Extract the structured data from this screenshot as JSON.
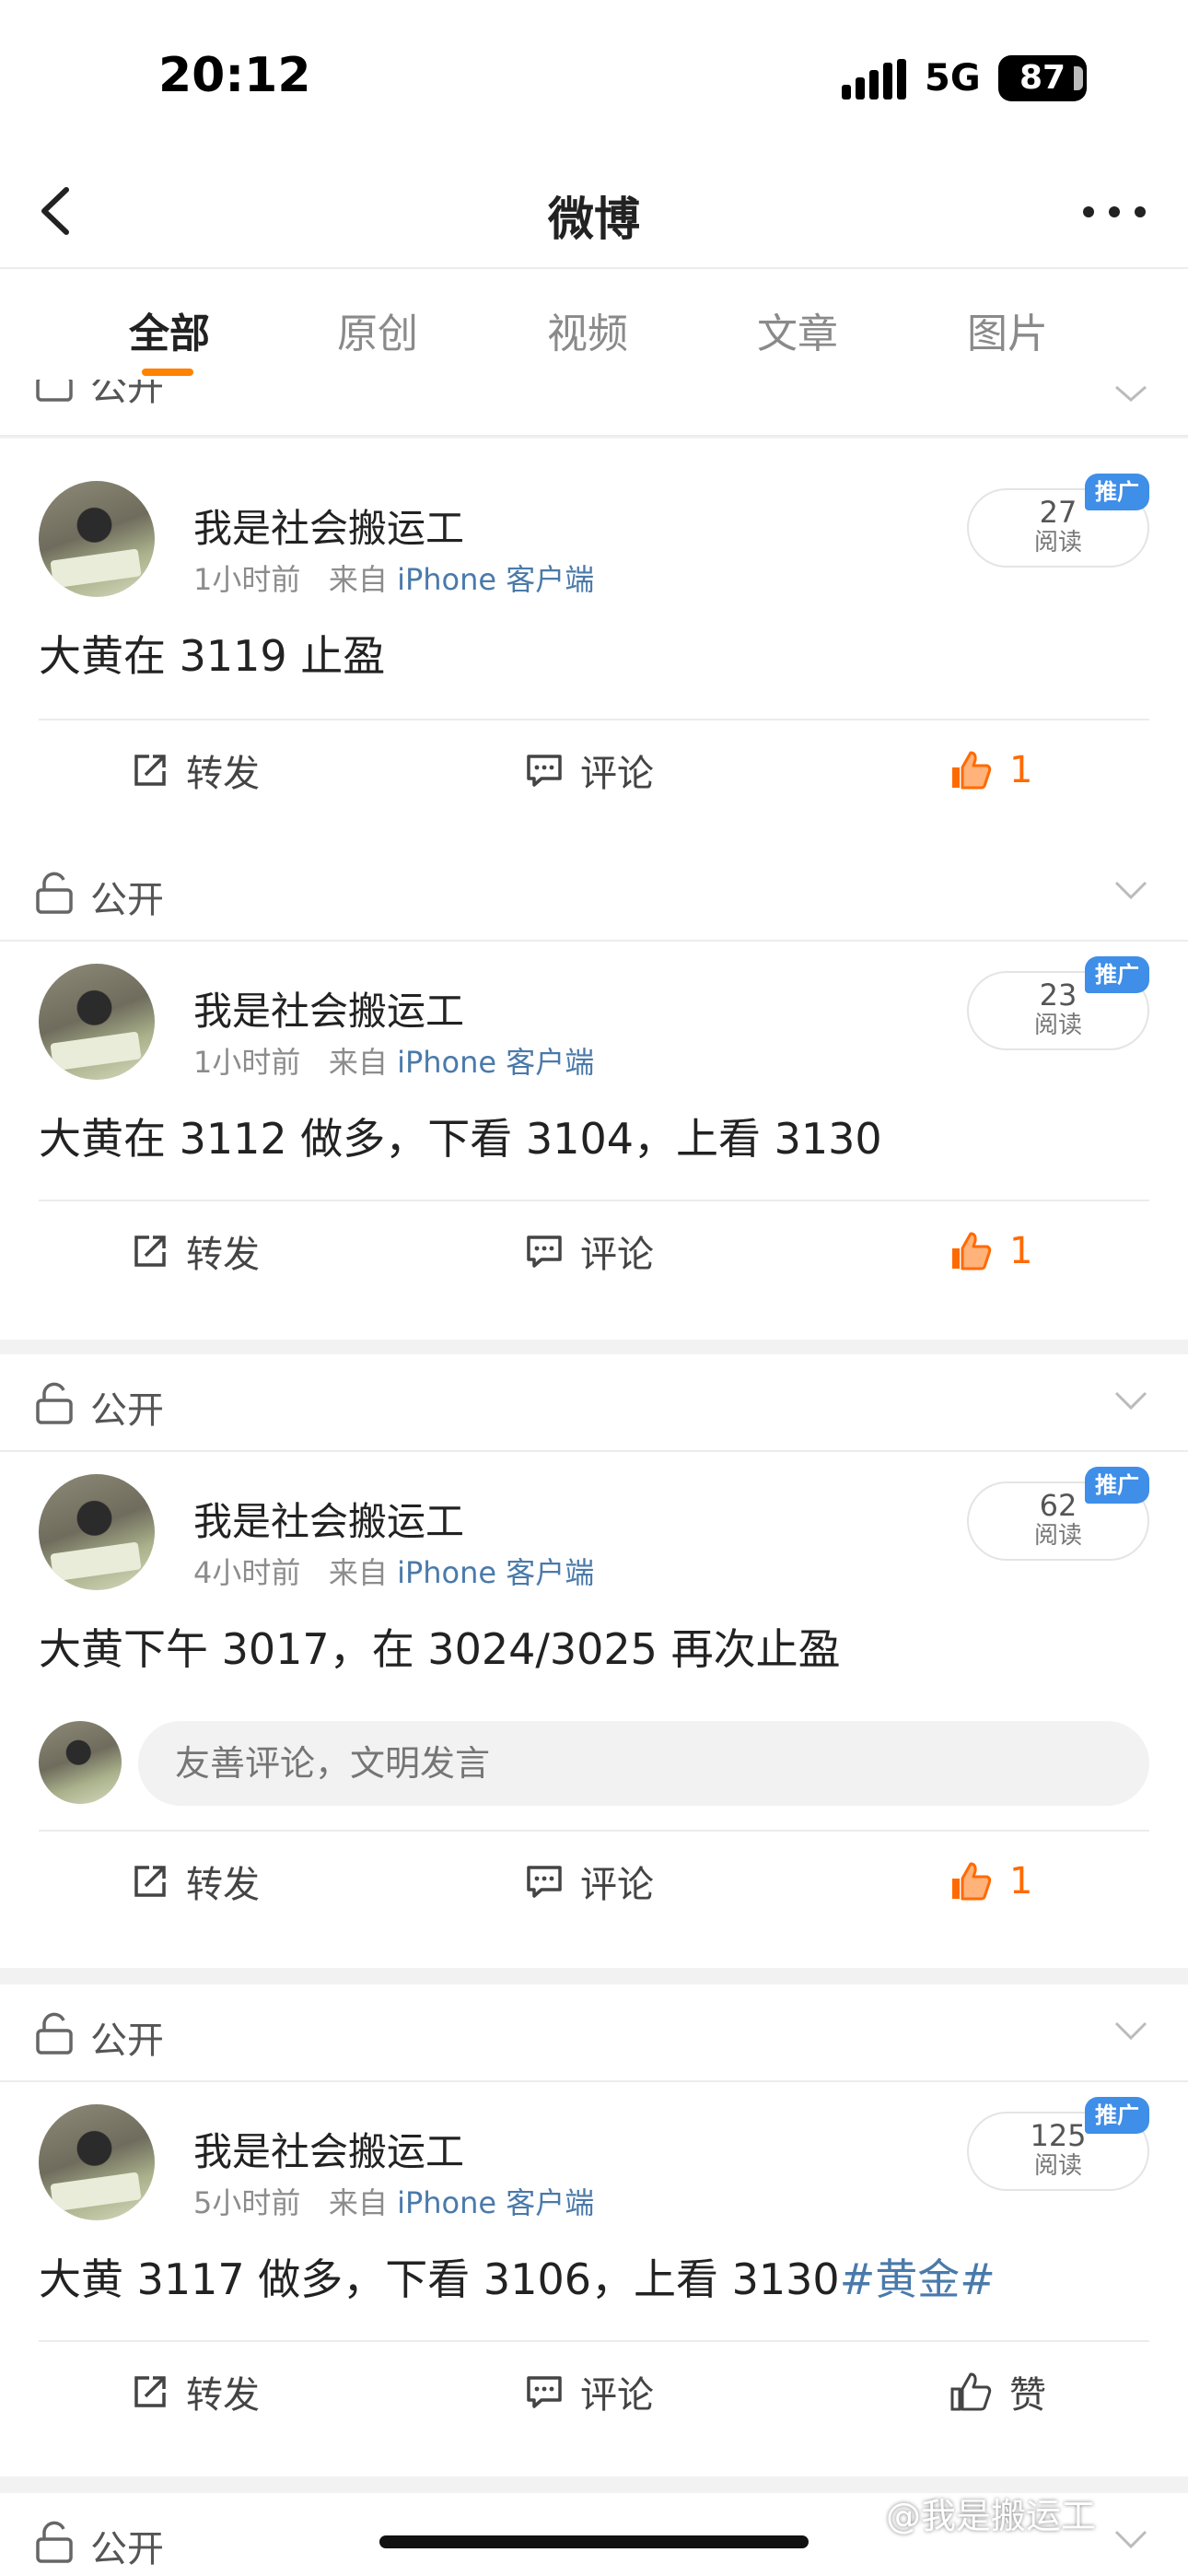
{
  "status_bar": {
    "time": "20:12",
    "network": "5G",
    "battery": "87"
  },
  "navbar": {
    "title": "微博",
    "back_icon": "chevron-left-icon",
    "more_icon": "more-dots-icon"
  },
  "tabs": [
    {
      "label": "全部",
      "active": true
    },
    {
      "label": "原创",
      "active": false
    },
    {
      "label": "视频",
      "active": false
    },
    {
      "label": "文章",
      "active": false
    },
    {
      "label": "图片",
      "active": false
    }
  ],
  "accent_color": "#ff8200",
  "link_color": "#4a7aaa",
  "like_active_color": "#ff6a00",
  "comment_placeholder": "友善评论，文明发言",
  "visibility_label": "公开",
  "posts": [
    {
      "author": "我是社会搬运工",
      "time": "1小时前",
      "source_prefix": "来自",
      "source": "iPhone 客户端",
      "reads": "27",
      "read_label": "阅读",
      "promo_label": "推广",
      "text": "大黄在 3119 止盈",
      "forward_label": "转发",
      "comment_label": "评论",
      "likes": "1",
      "liked": true
    },
    {
      "author": "我是社会搬运工",
      "time": "1小时前",
      "source_prefix": "来自",
      "source": "iPhone 客户端",
      "reads": "23",
      "read_label": "阅读",
      "promo_label": "推广",
      "text": "大黄在 3112 做多，下看 3104，上看 3130",
      "forward_label": "转发",
      "comment_label": "评论",
      "likes": "1",
      "liked": true
    },
    {
      "author": "我是社会搬运工",
      "time": "4小时前",
      "source_prefix": "来自",
      "source": "iPhone 客户端",
      "reads": "62",
      "read_label": "阅读",
      "promo_label": "推广",
      "text": "大黄下午 3017，在 3024/3025 再次止盈",
      "forward_label": "转发",
      "comment_label": "评论",
      "likes": "1",
      "liked": true
    },
    {
      "author": "我是社会搬运工",
      "time": "5小时前",
      "source_prefix": "来自",
      "source": "iPhone 客户端",
      "reads": "125",
      "read_label": "阅读",
      "promo_label": "推广",
      "text": "大黄 3117 做多，下看 3106，上看 3130",
      "hashtag": "#黄金#",
      "forward_label": "转发",
      "comment_label": "评论",
      "like_label": "赞",
      "liked": false
    }
  ],
  "watermark": "@我是搬运工"
}
